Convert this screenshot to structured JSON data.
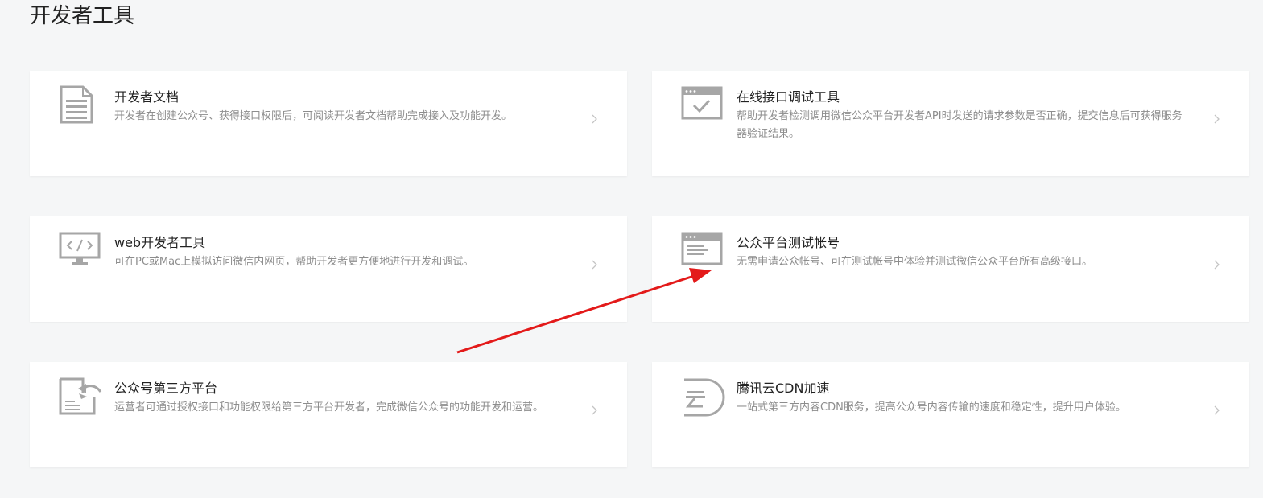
{
  "page": {
    "title": "开发者工具"
  },
  "cards": [
    {
      "title": "开发者文档",
      "desc": "开发者在创建公众号、获得接口权限后，可阅读开发者文档帮助完成接入及功能开发。",
      "icon": "document-icon"
    },
    {
      "title": "在线接口调试工具",
      "desc": "帮助开发者检测调用微信公众平台开发者API时发送的请求参数是否正确，提交信息后可获得服务器验证结果。",
      "icon": "browser-check-icon"
    },
    {
      "title": "web开发者工具",
      "desc": "可在PC或Mac上模拟访问微信内网页，帮助开发者更方便地进行开发和调试。",
      "icon": "monitor-code-icon"
    },
    {
      "title": "公众平台测试帐号",
      "desc": "无需申请公众帐号、可在测试帐号中体验并测试微信公众平台所有高级接口。",
      "icon": "browser-window-icon"
    },
    {
      "title": "公众号第三方平台",
      "desc": "运营者可通过授权接口和功能权限给第三方平台开发者，完成微信公众号的功能开发和运营。",
      "icon": "document-share-icon"
    },
    {
      "title": "腾讯云CDN加速",
      "desc": "一站式第三方内容CDN服务，提高公众号内容传输的速度和稳定性，提升用户体验。",
      "icon": "tencent-cloud-icon"
    }
  ],
  "colors": {
    "background": "#f5f6f7",
    "card": "#ffffff",
    "icon": "#a6a6a6",
    "annotation": "#e31a1a"
  },
  "annotation": {
    "type": "arrow",
    "points_to": "公众平台测试帐号"
  }
}
